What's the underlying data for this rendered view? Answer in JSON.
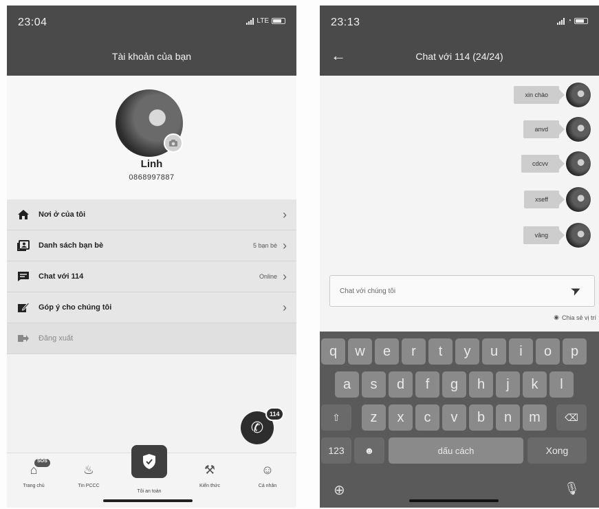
{
  "left_screen": {
    "status": {
      "time": "23:04",
      "network": "LTE"
    },
    "header_title": "Tài khoản của bạn",
    "profile": {
      "name": "Linh",
      "phone": "0868997887"
    },
    "menu": [
      {
        "label": "Nơi ở của tôi",
        "value": "",
        "icon": "home-icon"
      },
      {
        "label": "Danh sách bạn bè",
        "value": "5 bạn bè",
        "icon": "contacts-icon"
      },
      {
        "label": "Chat với 114",
        "value": "Online",
        "icon": "chat-icon"
      },
      {
        "label": "Góp ý cho chúng tôi",
        "value": "",
        "icon": "edit-icon"
      },
      {
        "label": "Đăng xuất",
        "value": "",
        "icon": "logout-icon"
      }
    ],
    "call_badge": "114",
    "nav": {
      "home": "Trang chủ",
      "sos_badge": "SOS",
      "news": "Tin PCCC",
      "safe": "Tôi an toàn",
      "knowledge": "Kiến thức",
      "personal": "Cá nhân"
    }
  },
  "right_screen": {
    "status": {
      "time": "23:13"
    },
    "header_title": "Chat với 114 (24/24)",
    "messages": [
      "xin chào",
      "anvd",
      "cdcvv",
      "xseff",
      "vâng"
    ],
    "input_placeholder": "Chat với chúng tôi",
    "share_location": "Chia sẻ vị trí",
    "keyboard": {
      "row1": [
        "q",
        "w",
        "e",
        "r",
        "t",
        "y",
        "u",
        "i",
        "o",
        "p"
      ],
      "row2": [
        "a",
        "s",
        "d",
        "f",
        "g",
        "h",
        "j",
        "k",
        "l"
      ],
      "row3": [
        "z",
        "x",
        "c",
        "v",
        "b",
        "n",
        "m"
      ],
      "numbers": "123",
      "space": "dấu cách",
      "done": "Xong"
    }
  }
}
